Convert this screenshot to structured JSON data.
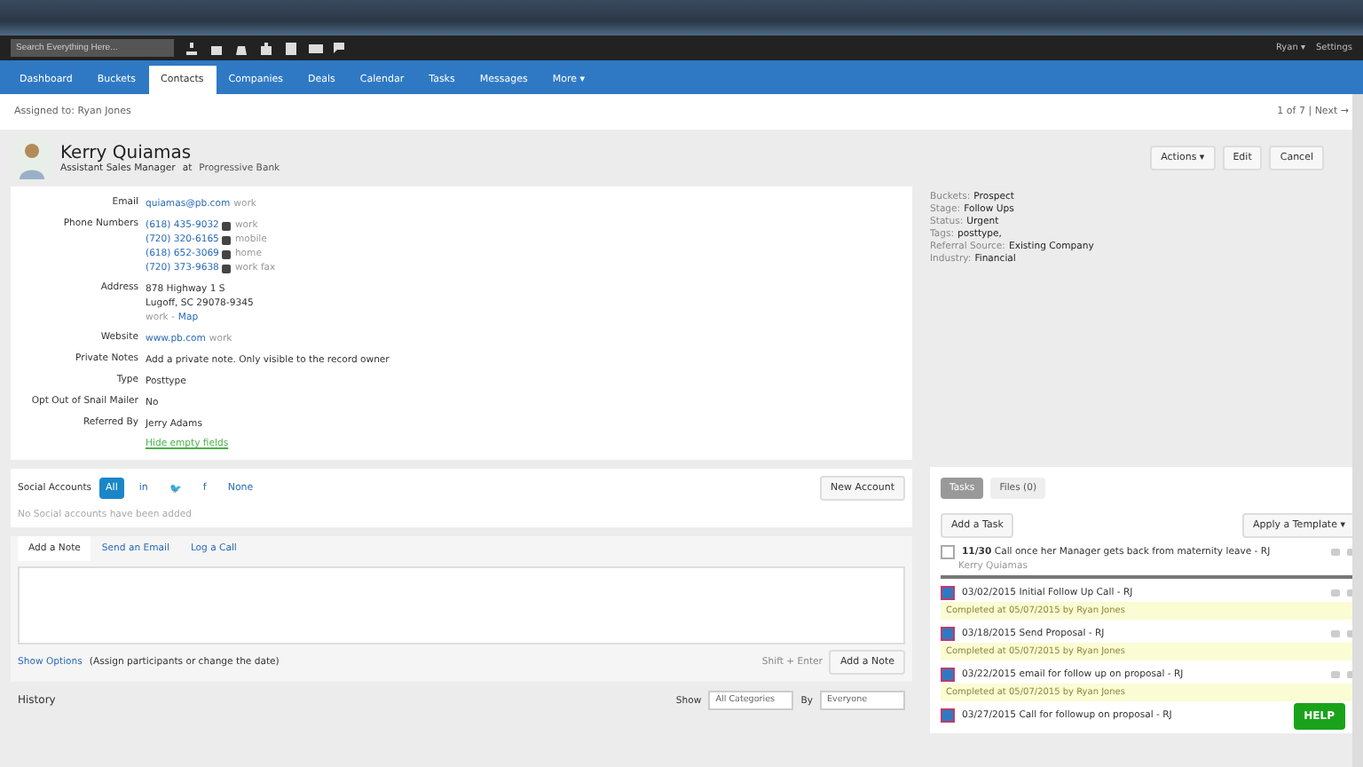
{
  "topbar": {
    "search_placeholder": "Search Everything Here...",
    "user": "Ryan ▾",
    "settings": "Settings"
  },
  "nav": [
    {
      "label": "Dashboard",
      "selected": false
    },
    {
      "label": "Buckets",
      "selected": false
    },
    {
      "label": "Contacts",
      "selected": true
    },
    {
      "label": "Companies",
      "selected": false
    },
    {
      "label": "Deals",
      "selected": false
    },
    {
      "label": "Calendar",
      "selected": false
    },
    {
      "label": "Tasks",
      "selected": false
    },
    {
      "label": "Messages",
      "selected": false
    },
    {
      "label": "More ▾",
      "selected": false
    }
  ],
  "assigned": "Assigned to: Ryan Jones",
  "pager": "1 of 7 | Next →",
  "contact": {
    "name": "Kerry Quiamas",
    "title": "Assistant Sales Manager",
    "at": "at",
    "company": "Progressive Bank"
  },
  "actions": [
    "Actions ▾",
    "Edit",
    "Cancel"
  ],
  "details": [
    {
      "label": "Email",
      "lines": [
        {
          "link": "quiamas@pb.com",
          "note": "work"
        }
      ]
    },
    {
      "label": "Phone Numbers",
      "lines": [
        {
          "link": "(618) 435-9032",
          "phone": true,
          "note": "work"
        },
        {
          "link": "(720) 320-6165",
          "phone": true,
          "note": "mobile"
        },
        {
          "link": "(618) 652-3069",
          "phone": true,
          "note": "home"
        },
        {
          "link": "(720) 373-9638",
          "phone": true,
          "note": "work fax"
        }
      ]
    },
    {
      "label": "Address",
      "lines": [
        {
          "text": "878 Highway 1 S"
        },
        {
          "text": "Lugoff, SC 29078-9345"
        },
        {
          "note": "work -",
          "link": "Map",
          "link_after": true
        }
      ]
    },
    {
      "label": "Website",
      "lines": [
        {
          "link": "www.pb.com",
          "note": "work"
        }
      ]
    },
    {
      "label": "Private Notes",
      "lines": [
        {
          "text": "Add a private note. Only visible to the record owner"
        }
      ]
    },
    {
      "label": "Type",
      "lines": [
        {
          "text": "Posttype"
        }
      ]
    },
    {
      "label": "Opt Out of Snail Mailer",
      "lines": [
        {
          "text": "No"
        }
      ]
    },
    {
      "label": "Referred By",
      "lines": [
        {
          "text": "Jerry Adams"
        }
      ]
    }
  ],
  "hide_empty": "Hide empty fields",
  "tags": [
    {
      "label": "Buckets:",
      "value": "Prospect"
    },
    {
      "label": "Stage:",
      "value": "Follow Ups"
    },
    {
      "label": "Status:",
      "value": "Urgent"
    },
    {
      "label": "Tags:",
      "value": "posttype,"
    },
    {
      "label": "Referral Source:",
      "value": "Existing Company"
    },
    {
      "label": "Industry:",
      "value": "Financial"
    }
  ],
  "social": {
    "title": "Social Accounts",
    "filters": [
      {
        "label": "All",
        "selected": true
      },
      {
        "label": "in",
        "selected": false
      },
      {
        "label": "🐦",
        "selected": false
      },
      {
        "label": "f",
        "selected": false
      },
      {
        "label": "None",
        "selected": false
      }
    ],
    "new": "New Account",
    "empty": "No Social accounts have been added"
  },
  "note_tabs": [
    {
      "label": "Add a Note",
      "selected": true
    },
    {
      "label": "Send an Email",
      "selected": false
    },
    {
      "label": "Log a Call",
      "selected": false
    }
  ],
  "show_options": "Show Options",
  "options_hint": "(Assign participants or change the date)",
  "shortcut": "Shift + Enter",
  "add_note": "Add a Note",
  "history": {
    "title": "History",
    "show": "Show",
    "category": "All Categories",
    "by": "By",
    "person": "Everyone"
  },
  "side_tabs": [
    {
      "label": "Tasks",
      "selected": true
    },
    {
      "label": "Files (0)",
      "selected": false
    }
  ],
  "add_task": "Add a Task",
  "template": "Apply a Template ▾",
  "tasks": [
    {
      "title": "**11/30** Call once her Manager gets back from maternity leave - RJ",
      "checked": false,
      "sub": "Kerry Quiamas"
    },
    {
      "title": "03/02/2015 Initial Follow Up Call - RJ",
      "checked": true,
      "completed": "Completed at 05/07/2015 by Ryan Jones"
    },
    {
      "title": "03/18/2015 Send Proposal - RJ",
      "checked": true,
      "completed": "Completed at 05/07/2015 by Ryan Jones"
    },
    {
      "title": "03/22/2015 email for follow up on proposal - RJ",
      "checked": true,
      "completed": "Completed at 05/07/2015 by Ryan Jones"
    },
    {
      "title": "03/27/2015 Call for followup on proposal - RJ",
      "checked": true
    }
  ],
  "help": "HELP"
}
